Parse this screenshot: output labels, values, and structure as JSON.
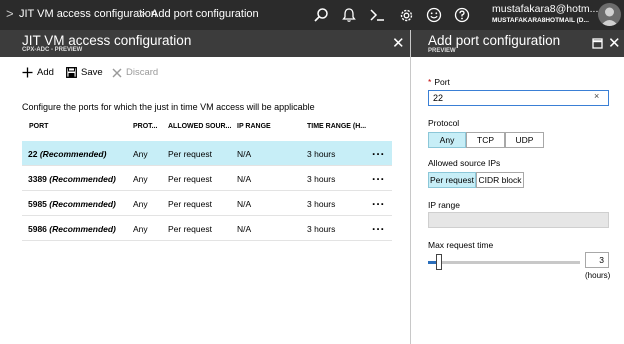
{
  "topbar": {
    "breadcrumb": [
      "JIT VM access configuration",
      "Add port configuration"
    ],
    "separator": ">",
    "user_name": "mustafakara8@hotm...",
    "user_directory": "MUSTAFAKARA8HOTMAIL (D...",
    "icons": [
      "search-icon",
      "bell-icon",
      "cloud-shell-icon",
      "gear-icon",
      "smiley-icon",
      "help-icon"
    ]
  },
  "left_blade": {
    "title": "JIT VM access configuration",
    "subtitle": "CPX-ADC - PREVIEW",
    "toolbar": {
      "add": "Add",
      "save": "Save",
      "discard": "Discard"
    },
    "description": "Configure the ports for which the just in time VM access will be applicable",
    "columns": [
      "PORT",
      "PROT...",
      "ALLOWED SOUR...",
      "IP RANGE",
      "TIME RANGE (H..."
    ],
    "rows": [
      {
        "port": "22",
        "tag": "(Recommended)",
        "protocol": "Any",
        "allowed": "Per request",
        "ip_range": "N/A",
        "time_range": "3 hours",
        "more": "...",
        "selected": true
      },
      {
        "port": "3389",
        "tag": "(Recommended)",
        "protocol": "Any",
        "allowed": "Per request",
        "ip_range": "N/A",
        "time_range": "3 hours",
        "more": "...",
        "selected": false
      },
      {
        "port": "5985",
        "tag": "(Recommended)",
        "protocol": "Any",
        "allowed": "Per request",
        "ip_range": "N/A",
        "time_range": "3 hours",
        "more": "...",
        "selected": false
      },
      {
        "port": "5986",
        "tag": "(Recommended)",
        "protocol": "Any",
        "allowed": "Per request",
        "ip_range": "N/A",
        "time_range": "3 hours",
        "more": "...",
        "selected": false
      }
    ]
  },
  "right_blade": {
    "title": "Add port configuration",
    "subtitle": "PREVIEW",
    "port": {
      "required_mark": "*",
      "label": "Port",
      "value": "22",
      "clear": "×"
    },
    "protocol": {
      "label": "Protocol",
      "options": [
        "Any",
        "TCP",
        "UDP"
      ],
      "selected": "Any"
    },
    "allowed_source": {
      "label": "Allowed source IPs",
      "options": [
        "Per request",
        "CIDR block"
      ],
      "selected": "Per request"
    },
    "ip_range": {
      "label": "IP range",
      "value": ""
    },
    "max_request_time": {
      "label": "Max request time",
      "value": "3",
      "unit": "(hours)"
    }
  },
  "colors": {
    "topbar": "#2b2b2b",
    "blade_header": "#3c3c3c",
    "selected": "#c7eef7",
    "accent": "#2a6ebb"
  }
}
